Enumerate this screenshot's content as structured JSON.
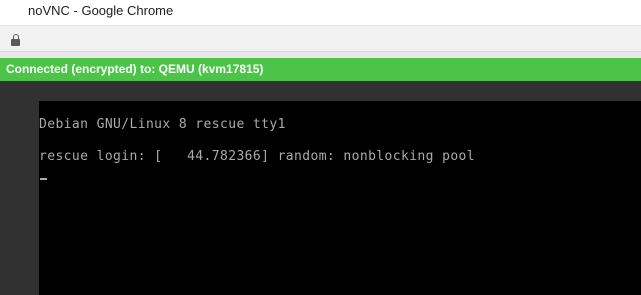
{
  "window": {
    "title": "noVNC - Google Chrome"
  },
  "addressbar": {
    "icon": "lock-icon"
  },
  "vnc": {
    "status_text": "Connected (encrypted) to: QEMU (kvm17815)",
    "status_color": "#4bc447",
    "background_color": "#313131",
    "console": {
      "background_color": "#000000",
      "text_color": "#aaaaaa",
      "lines": [
        "Debian GNU/Linux 8 rescue tty1",
        "rescue login: [   44.782366] random: nonblocking pool"
      ],
      "cursor": "_"
    }
  }
}
